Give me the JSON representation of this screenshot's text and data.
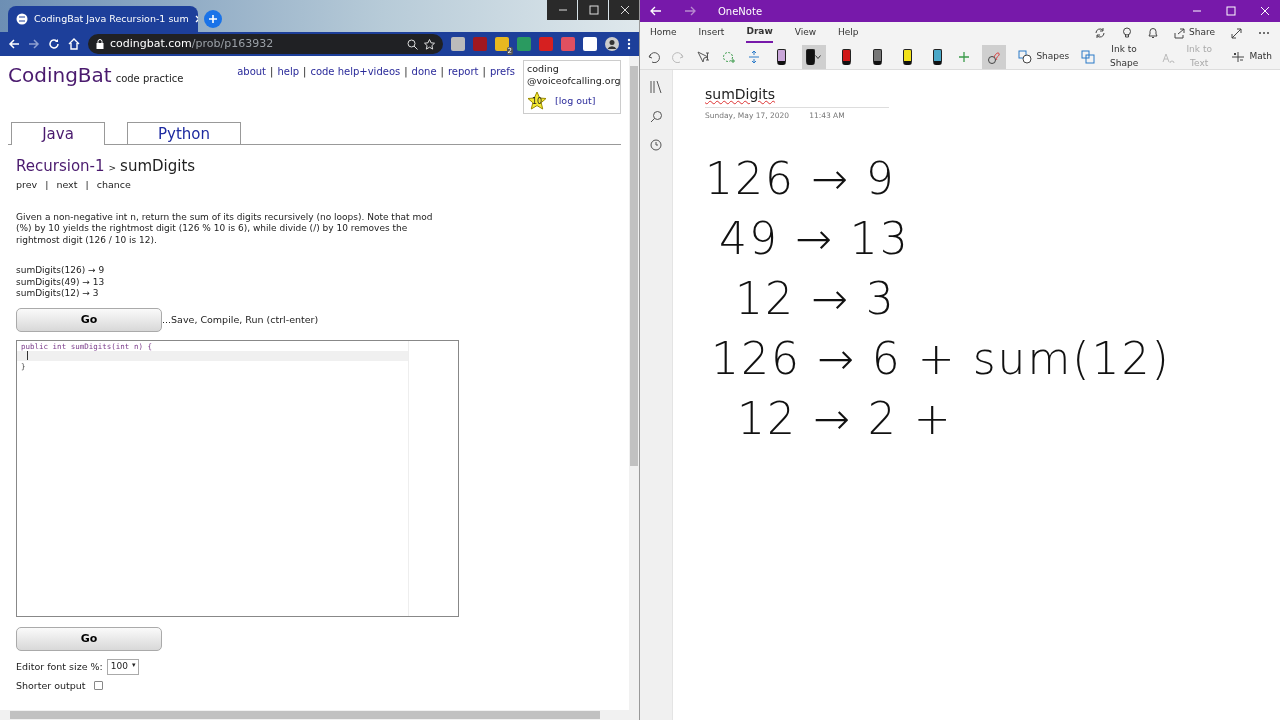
{
  "browser": {
    "tab_title": "CodingBat Java Recursion-1 sum",
    "url_host": "codingbat.com",
    "url_path": "/prob/p163932",
    "extension_badge": "2"
  },
  "site": {
    "logo": "CodingBat",
    "tagline": "code practice",
    "nav_separator": "|",
    "nav": [
      "about",
      "help",
      "code help+videos",
      "done",
      "report",
      "prefs"
    ],
    "user": {
      "name": "coding",
      "domain": "@voiceofcalling.org",
      "star": "10",
      "logout": "[log out]"
    }
  },
  "language_tabs": [
    {
      "label": "Java",
      "selected": true
    },
    {
      "label": "Python",
      "selected": false
    }
  ],
  "problem": {
    "section": "Recursion-1",
    "separator": ">",
    "name": "sumDigits",
    "link_separator": "|",
    "links": [
      "prev",
      "next",
      "chance"
    ],
    "description": "Given a non-negative int n, return the sum of its digits recursively (no loops). Note that mod (%) by 10 yields the rightmost digit (126 % 10 is 6), while divide (/) by 10 removes the rightmost digit (126 / 10 is 12).",
    "examples": [
      "sumDigits(126) → 9",
      "sumDigits(49) → 13",
      "sumDigits(12) → 3"
    ],
    "go_label": "Go",
    "go_hint": "...Save, Compile, Run (ctrl-enter)",
    "code_lines": [
      "public int sumDigits(int n) {",
      "}"
    ]
  },
  "go_bottom": "Go",
  "font_size": {
    "label": "Editor font size %:",
    "value": "100",
    "arrow": "▾"
  },
  "shorter_output": {
    "label": "Shorter output",
    "checked": false
  },
  "onenote": {
    "title": "OneNote",
    "ribbon_tabs": [
      {
        "label": "Home",
        "selected": false
      },
      {
        "label": "Insert",
        "selected": false
      },
      {
        "label": "Draw",
        "selected": true
      },
      {
        "label": "View",
        "selected": false
      },
      {
        "label": "Help",
        "selected": false
      }
    ],
    "share": "Share",
    "pens": [
      {
        "color": "#c9a6d9",
        "selected": false
      },
      {
        "color": "#111111",
        "selected": true
      },
      {
        "color": "#d01818",
        "selected": false
      },
      {
        "color": "#777777",
        "selected": false
      },
      {
        "color": "#f2e21a",
        "selected": false
      },
      {
        "color": "#4aa8c8",
        "selected": false
      }
    ],
    "tools": [
      {
        "label": "Shapes",
        "disabled": false
      },
      {
        "label": "Ink to Shape",
        "disabled": false
      },
      {
        "label": "Ink to Text",
        "disabled": true
      },
      {
        "label": "Math",
        "disabled": false
      }
    ],
    "page_title": "sumDigits",
    "date": "Sunday, May 17, 2020",
    "time": "11:43 AM",
    "ink_lines": [
      "126 → 9",
      "49 → 13",
      "12 → 3",
      "126 → 6 + sum(12)",
      "12 → 2 +"
    ]
  }
}
